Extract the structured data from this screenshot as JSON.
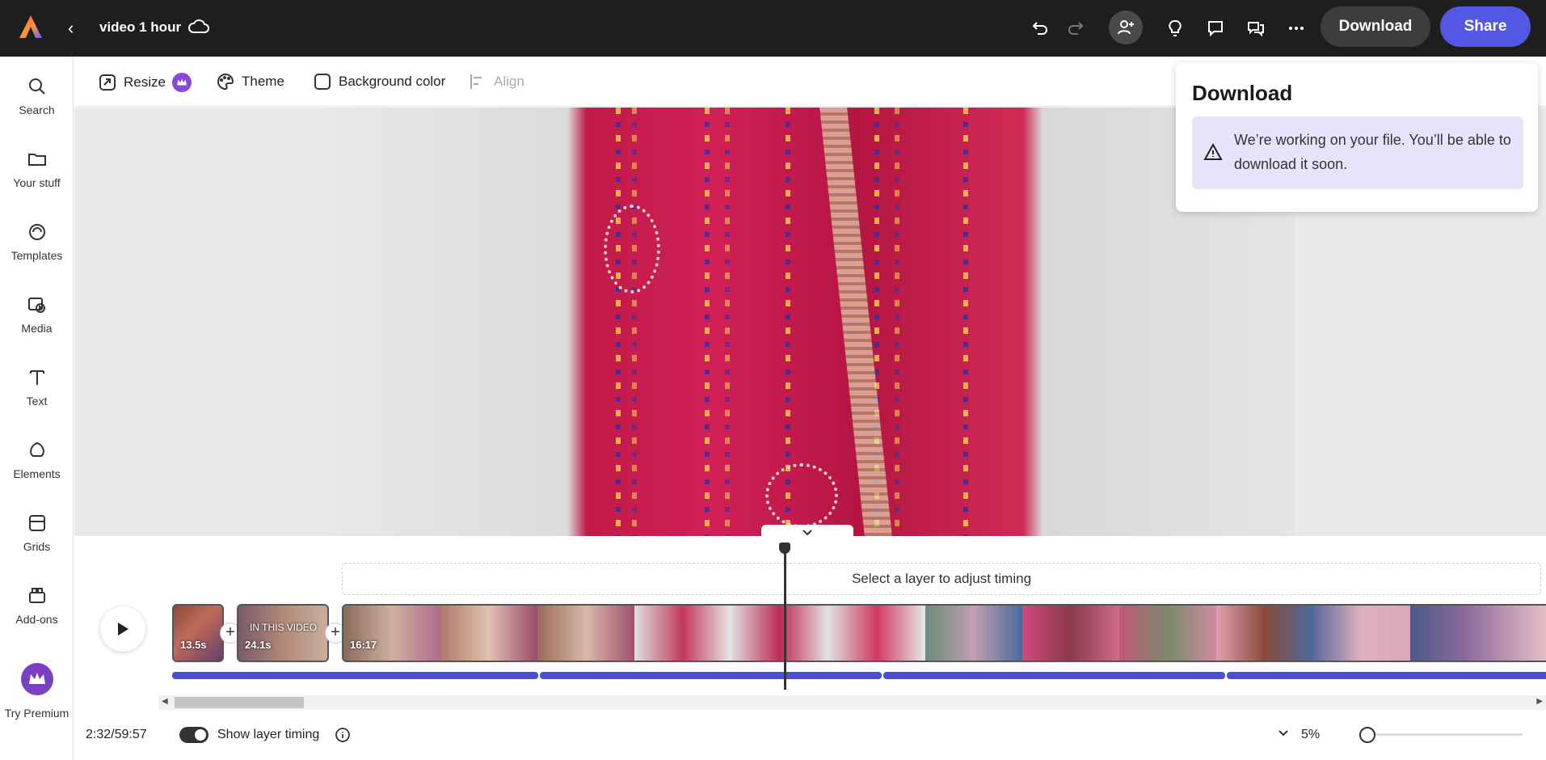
{
  "header": {
    "title": "video 1 hour",
    "download_label": "Download",
    "share_label": "Share",
    "accent": "#5258e4"
  },
  "sidebar": {
    "items": [
      {
        "label": "Search",
        "icon": "search-icon"
      },
      {
        "label": "Your stuff",
        "icon": "folder-icon"
      },
      {
        "label": "Templates",
        "icon": "templates-icon"
      },
      {
        "label": "Media",
        "icon": "media-icon"
      },
      {
        "label": "Text",
        "icon": "text-icon"
      },
      {
        "label": "Elements",
        "icon": "elements-icon"
      },
      {
        "label": "Grids",
        "icon": "grid-icon"
      },
      {
        "label": "Add-ons",
        "icon": "addons-icon"
      },
      {
        "label": "Try Premium",
        "icon": "crown-icon"
      }
    ]
  },
  "toolbar": {
    "resize_label": "Resize",
    "theme_label": "Theme",
    "background_label": "Background color",
    "align_label": "Align"
  },
  "popover": {
    "title": "Download",
    "message": "We’re working on your file. You’ll be able to download it soon."
  },
  "timeline": {
    "hint": "Select a layer to adjust timing",
    "clips": [
      {
        "label": "13.5s"
      },
      {
        "label": "24.1s",
        "overlay": "IN THIS VIDEO"
      },
      {
        "label": "16:17"
      }
    ],
    "current_time": "2:32/59:57",
    "show_layer_timing_label": "Show layer timing",
    "show_layer_timing": true,
    "zoom": "5%"
  }
}
